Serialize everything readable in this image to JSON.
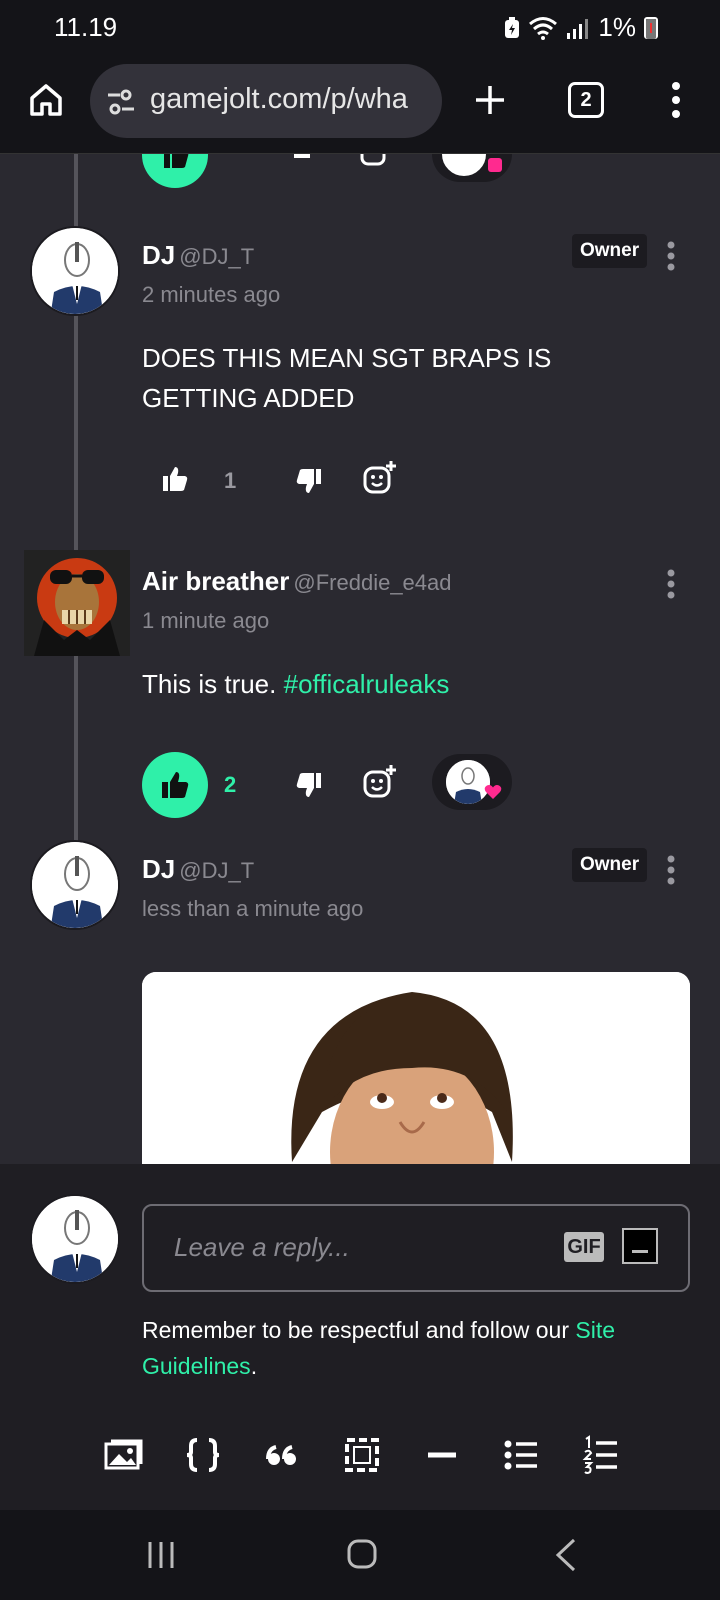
{
  "status_bar": {
    "time": "11.19",
    "battery_percent": "1%"
  },
  "browser": {
    "url": "gamejolt.com/p/wha",
    "tab_count": "2"
  },
  "comments": [
    {
      "name": "DJ",
      "handle": "@DJ_T",
      "badge": "Owner",
      "time_ago": "2 minutes ago",
      "text": "DOES THIS MEAN SGT BRAPS IS GETTING ADDED",
      "likes": "1",
      "liked": false
    },
    {
      "name": "Air breather",
      "handle": "@Freddie_e4ad",
      "time_ago": "1 minute ago",
      "text": "This is true.",
      "hashtag": "#officalruleaks",
      "likes": "2",
      "liked": true
    },
    {
      "name": "DJ",
      "handle": "@DJ_T",
      "badge": "Owner",
      "time_ago": "less than a minute ago"
    }
  ],
  "reply": {
    "placeholder": "Leave a reply...",
    "gif_label": "GIF",
    "reminder_prefix": "Remember to be respectful and follow our",
    "reminder_link": "Site Guidelines",
    "reminder_suffix": "."
  },
  "colors": {
    "accent": "#2ff0a9",
    "background": "#2a2930",
    "panel": "#1f1e23",
    "heart": "#ff2a8f"
  }
}
